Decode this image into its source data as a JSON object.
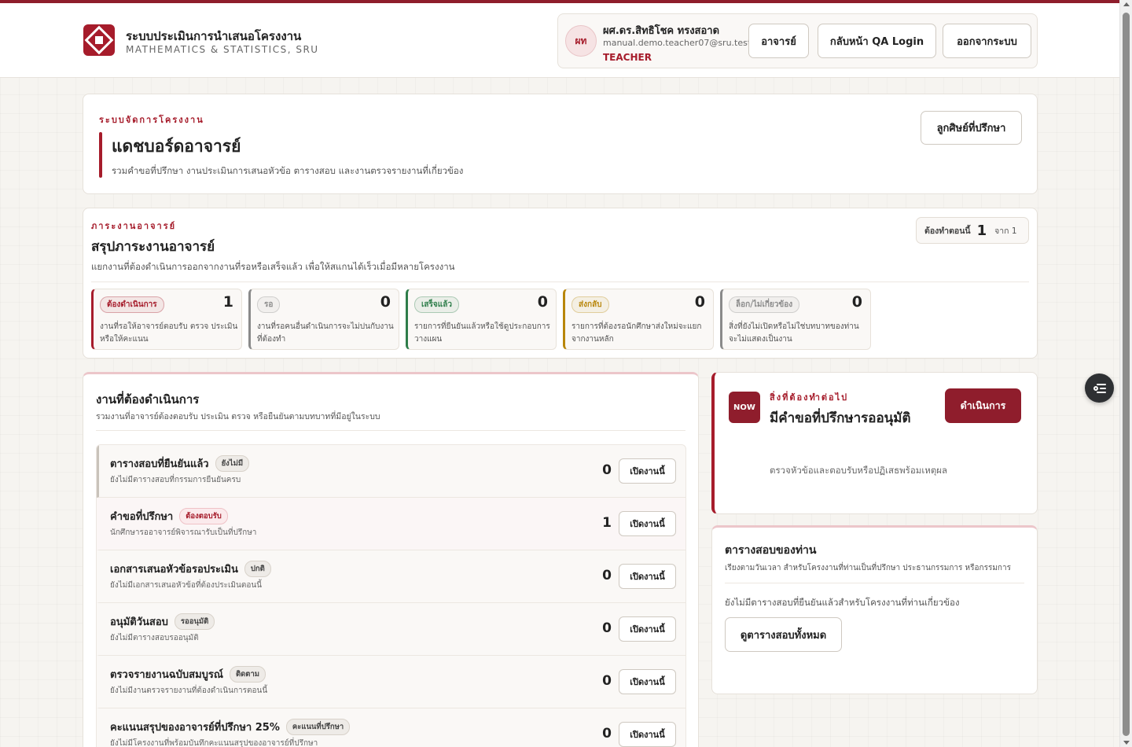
{
  "colors": {
    "accent": "#a61c2b",
    "accent_dark": "#8f1d2c"
  },
  "header": {
    "app_title": "ระบบประเมินการนำเสนอโครงงาน",
    "app_subtitle": "MATHEMATICS & STATISTICS, SRU",
    "user": {
      "initials": "ผท",
      "name": "ผศ.ดร.สิทธิโชค ทรงสอาด",
      "email": "manual.demo.teacher07@sru.test",
      "role": "TEACHER"
    },
    "buttons": {
      "teacher": "อาจารย์",
      "qa_home": "กลับหน้า QA Login",
      "logout": "ออกจากระบบ"
    }
  },
  "hero": {
    "eyebrow": "ระบบจัดการโครงงาน",
    "title": "แดชบอร์ดอาจารย์",
    "description": "รวมคำขอที่ปรึกษา งานประเมินการเสนอหัวข้อ ตารางสอบ และงานตรวจรายงานที่เกี่ยวข้อง",
    "advisees_button": "ลูกศิษย์ที่ปรึกษา"
  },
  "summary": {
    "eyebrow": "ภาระงานอาจารย์",
    "title": "สรุปภาระงานอาจารย์",
    "description": "แยกงานที่ต้องดำเนินการออกจากงานที่รอหรือเสร็จแล้ว เพื่อให้สแกนได้เร็วเมื่อมีหลายโครงงาน",
    "counter": {
      "label": "ต้องทำตอนนี้",
      "value": "1",
      "of": "จาก 1"
    },
    "stats": [
      {
        "label": "ต้องดำเนินการ",
        "value": "1",
        "desc": "งานที่รอให้อาจารย์ตอบรับ ตรวจ ประเมิน หรือให้คะแนน",
        "color": "#a61c2b"
      },
      {
        "label": "รอ",
        "value": "0",
        "desc": "งานที่รอคนอื่นดำเนินการจะไม่ปนกับงานที่ต้องทำ",
        "color": "#8a8a8a"
      },
      {
        "label": "เสร็จแล้ว",
        "value": "0",
        "desc": "รายการที่ยืนยันแล้วหรือใช้ดูประกอบการวางแผน",
        "color": "#2e7d4a"
      },
      {
        "label": "ส่งกลับ",
        "value": "0",
        "desc": "รายการที่ต้องรอนักศึกษาส่งใหม่จะแยกจากงานหลัก",
        "color": "#b8860b"
      },
      {
        "label": "ล็อก/ไม่เกี่ยวข้อง",
        "value": "0",
        "desc": "สิ่งที่ยังไม่เปิดหรือไม่ใช่บทบาทของท่าน จะไม่แสดงเป็นงาน",
        "color": "#8a8a8a"
      }
    ]
  },
  "tasks": {
    "title": "งานที่ต้องดำเนินการ",
    "description": "รวมงานที่อาจารย์ต้องตอบรับ ประเมิน ตรวจ หรือยืนยันตามบทบาทที่มีอยู่ในระบบ",
    "open_label": "เปิดงานนี้",
    "items": [
      {
        "name": "ตารางสอบที่ยืนยันแล้ว",
        "tag": "ยังไม่มี",
        "desc": "ยังไม่มีตารางสอบที่กรรมการยืนยันครบ",
        "count": "0"
      },
      {
        "name": "คำขอที่ปรึกษา",
        "tag": "ต้องตอบรับ",
        "desc": "นักศึกษารออาจารย์พิจารณารับเป็นที่ปรึกษา",
        "count": "1"
      },
      {
        "name": "เอกสารเสนอหัวข้อรอประเมิน",
        "tag": "ปกติ",
        "desc": "ยังไม่มีเอกสารเสนอหัวข้อที่ต้องประเมินตอนนี้",
        "count": "0"
      },
      {
        "name": "อนุมัติวันสอบ",
        "tag": "รออนุมัติ",
        "desc": "ยังไม่มีตารางสอบรออนุมัติ",
        "count": "0"
      },
      {
        "name": "ตรวจรายงานฉบับสมบูรณ์",
        "tag": "ติดตาม",
        "desc": "ยังไม่มีงานตรวจรายงานที่ต้องดำเนินการตอนนี้",
        "count": "0"
      },
      {
        "name": "คะแนนสรุปของอาจารย์ที่ปรึกษา 25%",
        "tag": "คะแนนที่ปรึกษา",
        "desc": "ยังไม่มีโครงงานที่พร้อมบันทึกคะแนนสรุปของอาจารย์ที่ปรึกษา",
        "count": "0"
      }
    ]
  },
  "next": {
    "badge": "NOW",
    "eyebrow": "สิ่งที่ต้องทำต่อไป",
    "title": "มีคำขอที่ปรึกษารออนุมัติ",
    "description": "ตรวจหัวข้อและตอบรับหรือปฏิเสธพร้อมเหตุผล",
    "button": "ดำเนินการ"
  },
  "schedule": {
    "title": "ตารางสอบของท่าน",
    "description": "เรียงตามวันเวลา สำหรับโครงงานที่ท่านเป็นที่ปรึกษา ประธานกรรมการ หรือกรรมการ",
    "empty": "ยังไม่มีตารางสอบที่ยืนยันแล้วสำหรับโครงงานที่ท่านเกี่ยวข้อง",
    "button": "ดูตารางสอบทั้งหมด"
  }
}
